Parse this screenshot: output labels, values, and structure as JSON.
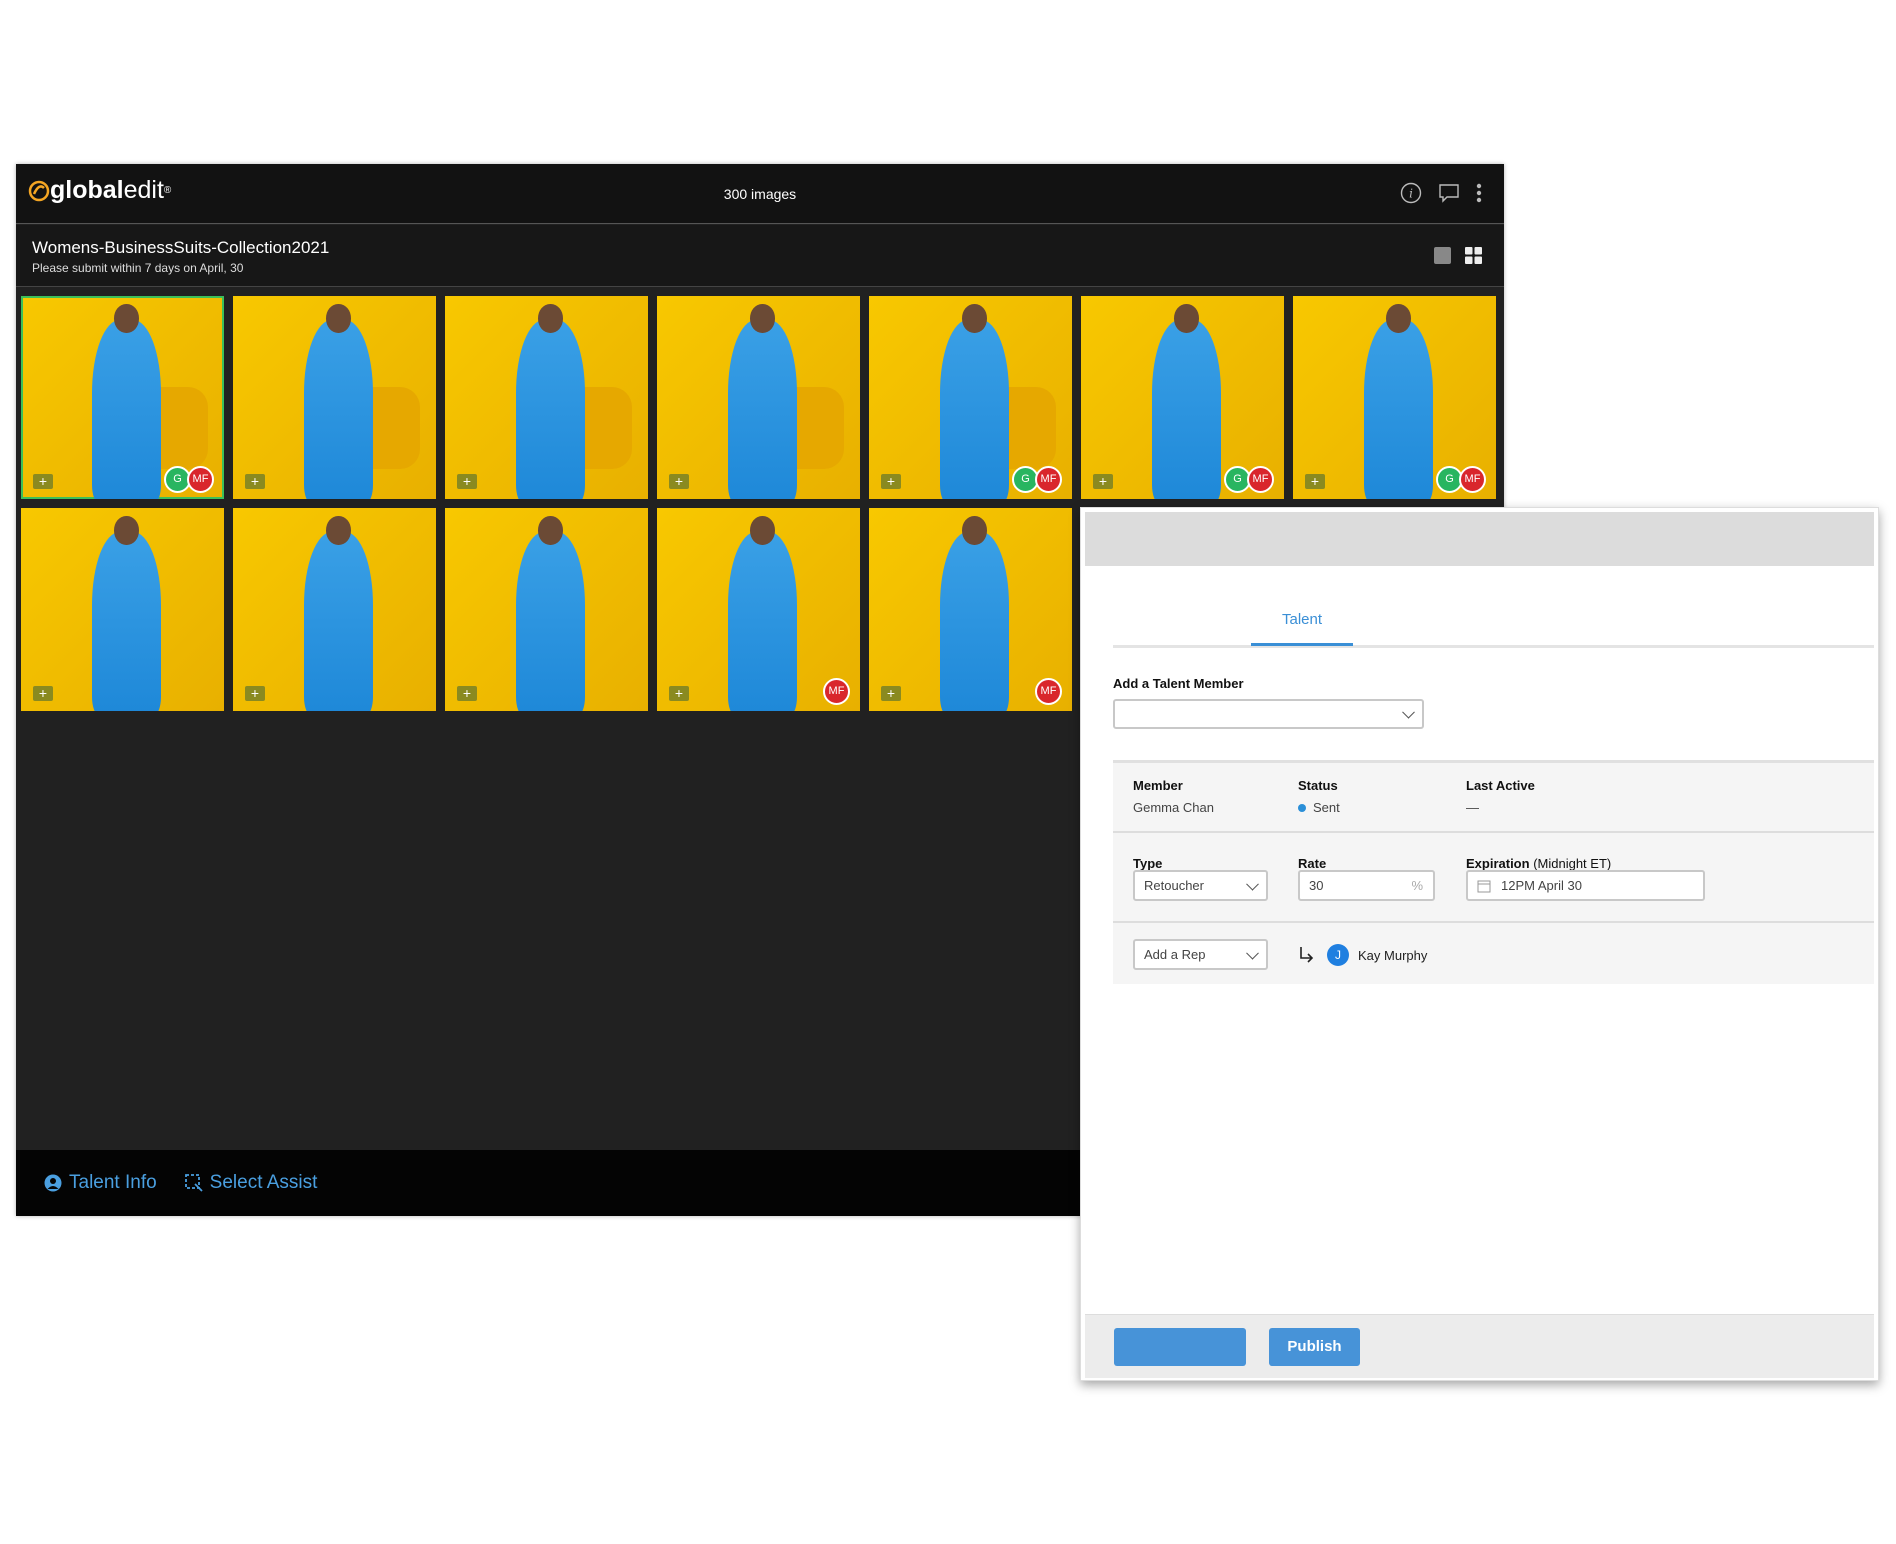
{
  "app": {
    "logo_bold": "global",
    "logo_light": "edit",
    "logo_mark": "®",
    "image_count": "300 images"
  },
  "header": {
    "title": "Womens-BusinessSuits-Collection2021",
    "subtitle": "Please submit within 7 days on April, 30"
  },
  "thumbnails": [
    {
      "selected": true,
      "badges": [
        "G",
        "MF"
      ],
      "pose": "chair"
    },
    {
      "selected": false,
      "badges": [],
      "pose": "chair"
    },
    {
      "selected": false,
      "badges": [],
      "pose": "chair"
    },
    {
      "selected": false,
      "badges": [],
      "pose": "chair"
    },
    {
      "selected": false,
      "badges": [
        "G",
        "MF"
      ],
      "pose": "chair"
    },
    {
      "selected": false,
      "badges": [
        "G",
        "MF"
      ],
      "pose": "standing"
    },
    {
      "selected": false,
      "badges": [
        "G",
        "MF"
      ],
      "pose": "standing"
    },
    {
      "selected": false,
      "badges": [],
      "pose": "standing"
    },
    {
      "selected": false,
      "badges": [],
      "pose": "standing"
    },
    {
      "selected": false,
      "badges": [],
      "pose": "standing"
    },
    {
      "selected": false,
      "badges": [
        "MF"
      ],
      "pose": "standing"
    },
    {
      "selected": false,
      "badges": [
        "MF"
      ],
      "pose": "standing"
    }
  ],
  "bottombar": {
    "talent_info": "Talent Info",
    "select_assist": "Select Assist"
  },
  "panel": {
    "tab": "Talent",
    "add_member_label": "Add a Talent Member",
    "add_member_value": "",
    "member_header": "Member",
    "status_header": "Status",
    "last_active_header": "Last Active",
    "member": "Gemma Chan",
    "status": "Sent",
    "last_active": "—",
    "type_label": "Type",
    "type_value": "Retoucher",
    "rate_label": "Rate",
    "rate_value": "30",
    "rate_unit": "%",
    "expiration_label": "Expiration",
    "expiration_note": "(Midnight ET)",
    "expiration_value": "12PM April 30",
    "rep_placeholder": "Add a Rep",
    "rep_initial": "J",
    "rep_name": "Kay Murphy",
    "publish": "Publish"
  },
  "colors": {
    "accent": "#4793d8",
    "badge_g": "#28b560",
    "badge_mf": "#d9262c",
    "status_sent": "#2a8fd8",
    "logo": "#f5a623"
  }
}
